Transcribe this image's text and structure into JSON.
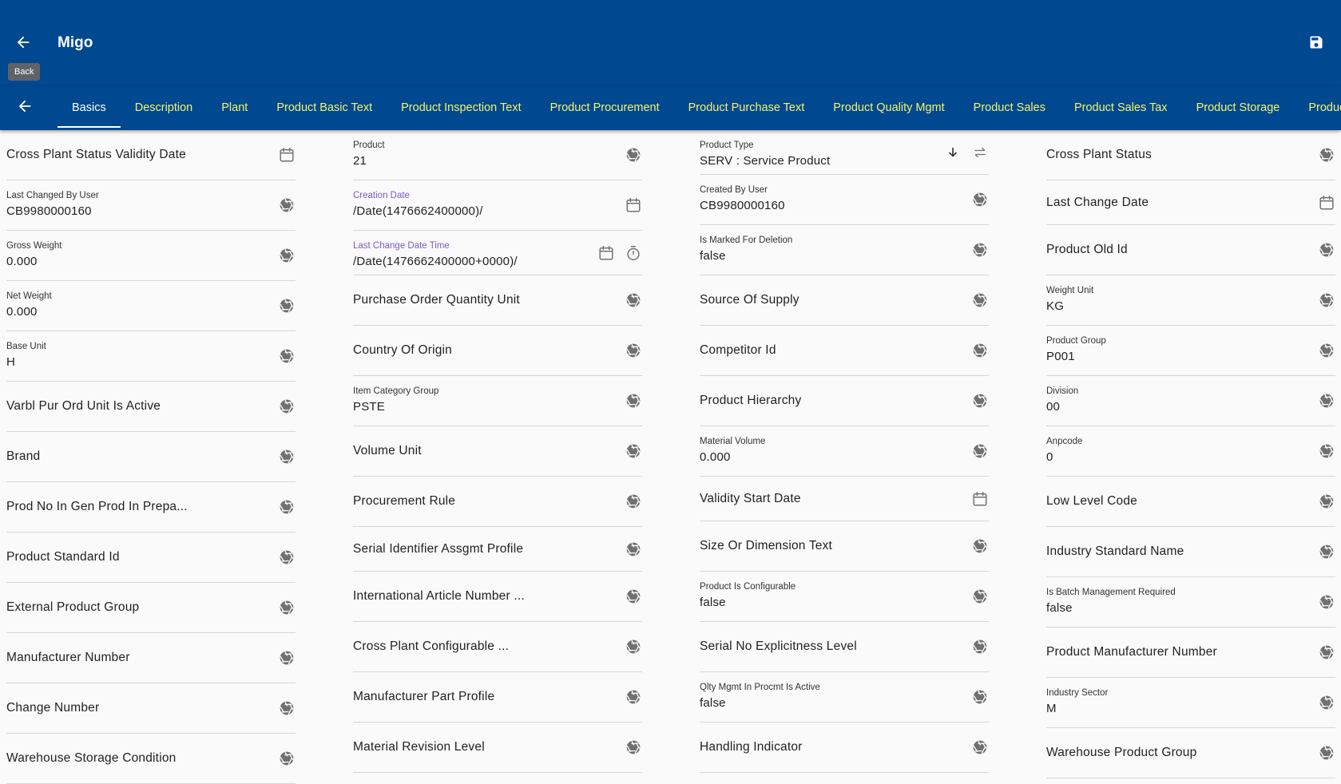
{
  "header": {
    "title": "Migo",
    "back_tooltip": "Back",
    "accent": "#004890",
    "tab_color": "#f4f36b"
  },
  "tabs": [
    {
      "label": "Basics",
      "active": true
    },
    {
      "label": "Description"
    },
    {
      "label": "Plant"
    },
    {
      "label": "Product Basic Text"
    },
    {
      "label": "Product Inspection Text"
    },
    {
      "label": "Product Procurement"
    },
    {
      "label": "Product Purchase Text"
    },
    {
      "label": "Product Quality Mgmt"
    },
    {
      "label": "Product Sales"
    },
    {
      "label": "Product Sales Tax"
    },
    {
      "label": "Product Storage"
    },
    {
      "label": "Product Units"
    }
  ],
  "columns": [
    [
      {
        "label": "Cross Plant Status Validity Date",
        "value": "",
        "icons": [
          "calendar-icon"
        ]
      },
      {
        "label": "Last Changed By User",
        "value": "CB9980000160",
        "icons": [
          "aperture-icon"
        ]
      },
      {
        "label": "Gross Weight",
        "value": "0.000",
        "icons": [
          "aperture-icon"
        ]
      },
      {
        "label": "Net Weight",
        "value": "0.000",
        "icons": [
          "aperture-icon"
        ]
      },
      {
        "label": "Base Unit",
        "value": "H",
        "icons": [
          "aperture-icon"
        ]
      },
      {
        "label": "Varbl Pur Ord Unit Is Active",
        "value": "",
        "icons": [
          "aperture-icon"
        ]
      },
      {
        "label": "Brand",
        "value": "",
        "icons": [
          "aperture-icon"
        ]
      },
      {
        "label": "Prod No In Gen Prod In Prepa...",
        "value": "",
        "icons": [
          "aperture-icon"
        ]
      },
      {
        "label": "Product Standard Id",
        "value": "",
        "icons": [
          "aperture-icon"
        ]
      },
      {
        "label": "External Product Group",
        "value": "",
        "icons": [
          "aperture-icon"
        ]
      },
      {
        "label": "Manufacturer Number",
        "value": "",
        "icons": [
          "aperture-icon"
        ]
      },
      {
        "label": "Change Number",
        "value": "",
        "icons": [
          "aperture-icon"
        ]
      },
      {
        "label": "Warehouse Storage Condition",
        "value": "",
        "icons": [
          "aperture-icon"
        ]
      }
    ],
    [
      {
        "label": "Product",
        "value": "21",
        "icons": [
          "aperture-icon"
        ]
      },
      {
        "label": "Creation Date",
        "value": "/Date(1476662400000)/",
        "icons": [
          "calendar-icon"
        ],
        "accent": true
      },
      {
        "label": "Last Change Date Time",
        "value": "/Date(1476662400000+0000)/",
        "icons": [
          "calendar-icon",
          "timer-icon"
        ],
        "accent": true,
        "short": true
      },
      {
        "label": "Purchase Order Quantity Unit",
        "value": "",
        "icons": [
          "aperture-icon"
        ]
      },
      {
        "label": "Country Of Origin",
        "value": "",
        "icons": [
          "aperture-icon"
        ]
      },
      {
        "label": "Item Category Group",
        "value": "PSTE",
        "icons": [
          "aperture-icon"
        ]
      },
      {
        "label": "Volume Unit",
        "value": "",
        "icons": [
          "aperture-icon"
        ]
      },
      {
        "label": "Procurement Rule",
        "value": "",
        "icons": [
          "aperture-icon"
        ]
      },
      {
        "label": "Serial Identifier Assgmt Profile",
        "value": "",
        "icons": [
          "aperture-icon"
        ],
        "short": true
      },
      {
        "label": "International Article Number ...",
        "value": "",
        "icons": [
          "aperture-icon"
        ]
      },
      {
        "label": "Cross Plant Configurable ...",
        "value": "",
        "icons": [
          "aperture-icon"
        ]
      },
      {
        "label": "Manufacturer Part Profile",
        "value": "",
        "icons": [
          "aperture-icon"
        ]
      },
      {
        "label": "Material Revision Level",
        "value": "",
        "icons": [
          "aperture-icon"
        ]
      }
    ],
    [
      {
        "label": "Product Type",
        "value": "SERV : Service Product",
        "icons": [
          "arrow-down-icon",
          "swap-icon"
        ],
        "short": true
      },
      {
        "label": "Created By User",
        "value": "CB9980000160",
        "icons": [
          "aperture-icon"
        ]
      },
      {
        "label": "Is Marked For Deletion",
        "value": "false",
        "icons": [
          "aperture-icon"
        ]
      },
      {
        "label": "Source Of Supply",
        "value": "",
        "icons": [
          "aperture-icon"
        ]
      },
      {
        "label": "Competitor Id",
        "value": "",
        "icons": [
          "aperture-icon"
        ]
      },
      {
        "label": "Product Hierarchy",
        "value": "",
        "icons": [
          "aperture-icon"
        ]
      },
      {
        "label": "Material Volume",
        "value": "0.000",
        "icons": [
          "aperture-icon"
        ]
      },
      {
        "label": "Validity Start Date",
        "value": "",
        "icons": [
          "calendar-icon"
        ],
        "short": true
      },
      {
        "label": "Size Or Dimension Text",
        "value": "",
        "icons": [
          "aperture-icon"
        ]
      },
      {
        "label": "Product Is Configurable",
        "value": "false",
        "icons": [
          "aperture-icon"
        ]
      },
      {
        "label": "Serial No Explicitness Level",
        "value": "",
        "icons": [
          "aperture-icon"
        ]
      },
      {
        "label": "Qlty Mgmt In Procmt Is Active",
        "value": "false",
        "icons": [
          "aperture-icon"
        ]
      },
      {
        "label": "Handling Indicator",
        "value": "",
        "icons": [
          "aperture-icon"
        ]
      }
    ],
    [
      {
        "label": "Cross Plant Status",
        "value": "",
        "icons": [
          "aperture-icon"
        ]
      },
      {
        "label": "Last Change Date",
        "value": "",
        "icons": [
          "calendar-icon"
        ],
        "short": true
      },
      {
        "label": "Product Old Id",
        "value": "",
        "icons": [
          "aperture-icon"
        ]
      },
      {
        "label": "Weight Unit",
        "value": "KG",
        "icons": [
          "aperture-icon"
        ]
      },
      {
        "label": "Product Group",
        "value": "P001",
        "icons": [
          "aperture-icon"
        ]
      },
      {
        "label": "Division",
        "value": "00",
        "icons": [
          "aperture-icon"
        ]
      },
      {
        "label": "Anpcode",
        "value": "0",
        "icons": [
          "aperture-icon"
        ]
      },
      {
        "label": "Low Level Code",
        "value": "",
        "icons": [
          "aperture-icon"
        ]
      },
      {
        "label": "Industry Standard Name",
        "value": "",
        "icons": [
          "aperture-icon"
        ]
      },
      {
        "label": "Is Batch Management Required",
        "value": "false",
        "icons": [
          "aperture-icon"
        ]
      },
      {
        "label": "Product Manufacturer Number",
        "value": "",
        "icons": [
          "aperture-icon"
        ]
      },
      {
        "label": "Industry Sector",
        "value": "M",
        "icons": [
          "aperture-icon"
        ]
      },
      {
        "label": "Warehouse Product Group",
        "value": "",
        "icons": [
          "aperture-icon"
        ]
      }
    ]
  ]
}
